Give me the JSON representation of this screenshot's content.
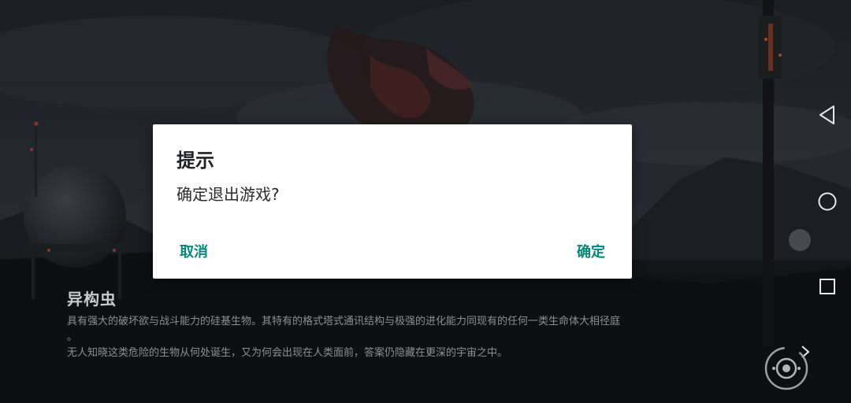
{
  "dialog": {
    "title": "提示",
    "message": "确定退出游戏?",
    "cancel_label": "取消",
    "confirm_label": "确定",
    "accent_color": "#00897b"
  },
  "caption": {
    "title": "异构虫",
    "description_line1": "具有强大的破坏欲与战斗能力的硅基生物。其特有的格式塔式通讯结构与极强的进化能力同现有的任何一类生命体大相径庭",
    "description_line1_tail": "。",
    "description_line2": "无人知晓这类危险的生物从何处诞生，又为何会出现在人类面前，答案仍隐藏在更深的宇宙之中。"
  },
  "navbar": {
    "back_icon": "triangle-back-icon",
    "home_icon": "circle-home-icon",
    "recents_icon": "square-recents-icon",
    "expand_icon": "chevron-right-icon"
  },
  "floating_button": {
    "icon": "game-assistant-icon"
  }
}
